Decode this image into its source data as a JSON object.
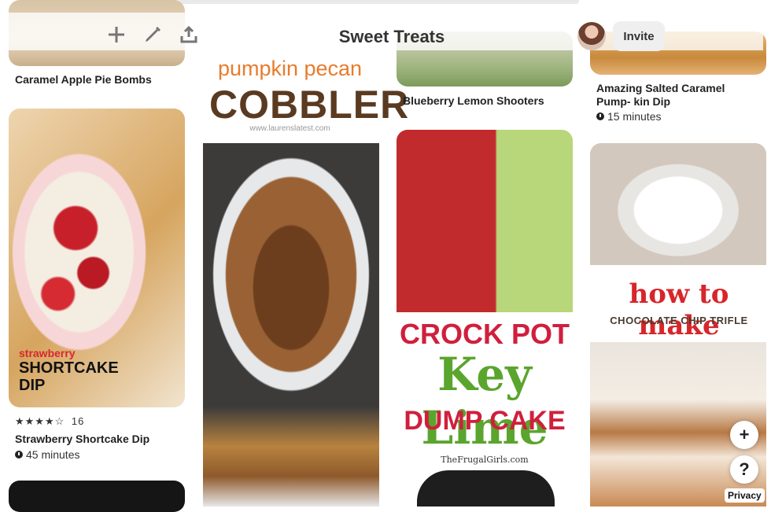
{
  "toolbar": {
    "title": "Sweet Treats",
    "invite_label": "Invite",
    "icons": [
      "plus-icon",
      "pencil-icon",
      "share-icon"
    ]
  },
  "pins": {
    "p1": {
      "title": "Caramel Apple Pie Bombs"
    },
    "p2": {
      "overlay_small": "strawberry",
      "overlay_big": "SHORTCAKE DIP",
      "rating_count": "16",
      "rating_stars": "★★★★☆",
      "title": "Strawberry Shortcake Dip",
      "time": "45 minutes"
    },
    "p3": {
      "overlay_line1": "pumpkin pecan",
      "overlay_line2": "COBBLER",
      "overlay_url": "www.laurenslatest.com"
    },
    "p4": {
      "title": "Blueberry Lemon Shooters"
    },
    "p5": {
      "overlay_line1": "CROCK POT",
      "overlay_line2": "Key Lime",
      "overlay_line3": "DUMP CAKE",
      "overlay_url": "TheFrugalGirls.com"
    },
    "p6": {
      "title": "Amazing Salted Caramel Pump- kin Dip",
      "time": "15 minutes"
    },
    "p7": {
      "overlay_line1": "how to make",
      "overlay_line2": "CHOCOLATE CHIP TRIFLE"
    }
  },
  "fab": {
    "add": "+",
    "help": "?"
  },
  "footer": {
    "privacy": "Privacy"
  }
}
